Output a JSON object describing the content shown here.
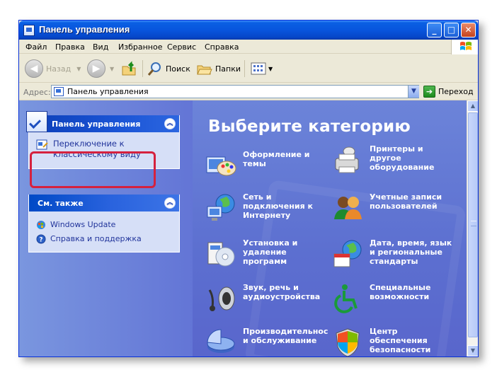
{
  "window": {
    "title": "Панель управления",
    "minimize": "_",
    "maximize": "□",
    "close": "✕"
  },
  "menu": [
    "Файл",
    "Правка",
    "Вид",
    "Избранное",
    "Сервис",
    "Справка"
  ],
  "toolbar": {
    "back": "Назад",
    "search": "Поиск",
    "folders": "Папки"
  },
  "address": {
    "label": "Адрес:",
    "value": "Панель управления",
    "go": "Переход"
  },
  "left_panel": {
    "control_panel_title": "Панель управления",
    "switch_view_link": "Переключение к\nклассическому виду",
    "see_also_title": "См. также",
    "see_also": [
      "Windows Update",
      "Справка и поддержка"
    ]
  },
  "main": {
    "heading": "Выберите категорию",
    "categories": [
      "Оформление и\nтемы",
      "Принтеры и\nдругое\nоборудование",
      "Сеть и\nподключения к\nИнтернету",
      "Учетные записи\nпользователей",
      "Установка и\nудаление\nпрограмм",
      "Дата, время, язык\nи региональные\nстандарты",
      "Звук, речь и\nаудиоустройства",
      "Специальные\nвозможности",
      "Производительнос\nи обслуживание",
      "Центр\nобеспечения\nбезопасности"
    ]
  },
  "colors": {
    "titlebar": "#0855dd",
    "left_pane": "#7a96df",
    "main_pane": "#5c6fd0",
    "highlight_border": "#d5213e"
  }
}
